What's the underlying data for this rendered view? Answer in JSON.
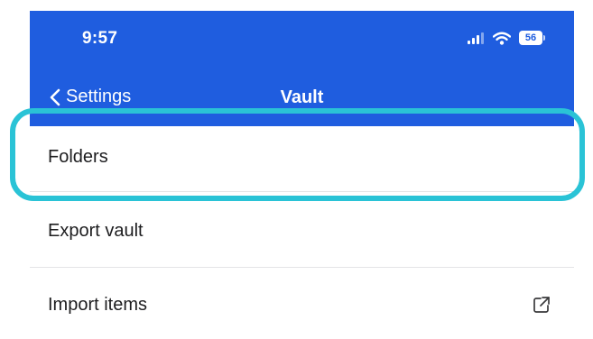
{
  "status_bar": {
    "time": "9:57",
    "battery_level": "56",
    "icons": [
      "signal-icon",
      "wifi-icon",
      "battery-icon"
    ]
  },
  "nav": {
    "back_label": "Settings",
    "back_icon": "chevron-left-icon",
    "title": "Vault"
  },
  "list": {
    "items": [
      {
        "label": "Folders"
      },
      {
        "label": "Export vault"
      },
      {
        "label": "Import items",
        "trailing_icon": "external-link-icon"
      }
    ]
  },
  "colors": {
    "header_bg": "#1f5ddf",
    "highlight": "#2ac3d6",
    "text": "#1d1d1f",
    "divider": "#e4e4e6"
  }
}
